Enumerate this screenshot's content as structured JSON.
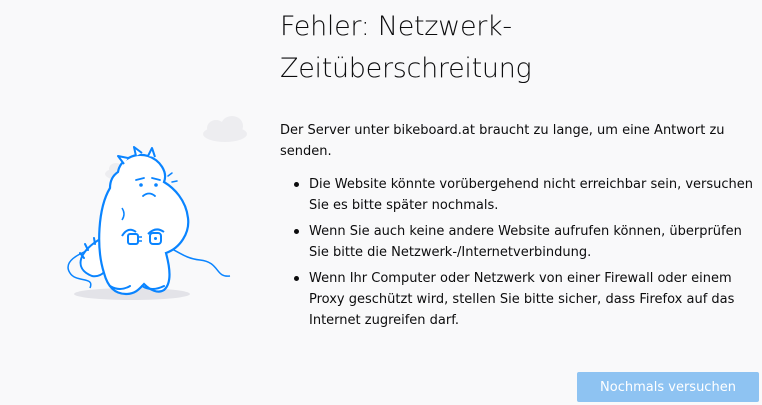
{
  "error": {
    "title_line1": "Fehler: Netzwerk-",
    "title_line2": "Zeitüberschreitung",
    "description": "Der Server unter bikeboard.at braucht zu lange, um eine Antwort zu senden.",
    "reasons": [
      "Die Website könnte vorübergehend nicht erreichbar sein, versuchen Sie es bitte später nochmals.",
      "Wenn Sie auch keine andere Website aufrufen können, überprüfen Sie bitte die Netzwerk-/Internetverbindung.",
      "Wenn Ihr Computer oder Netzwerk von einer Firewall oder einem Proxy geschützt wird, stellen Sie bitte sicher, dass Firefox auf das Internet zugreifen darf."
    ]
  },
  "actions": {
    "retry_label": "Nochmals versuchen"
  },
  "illustration": {
    "icon": "unplugged-dino-icon",
    "accent_color": "#0a84ff",
    "cloud_color": "#ededf0"
  },
  "colors": {
    "background": "#f9f9fa",
    "text": "#0c0c0d",
    "button_bg": "#8ec3f2",
    "button_text": "#ffffff"
  }
}
